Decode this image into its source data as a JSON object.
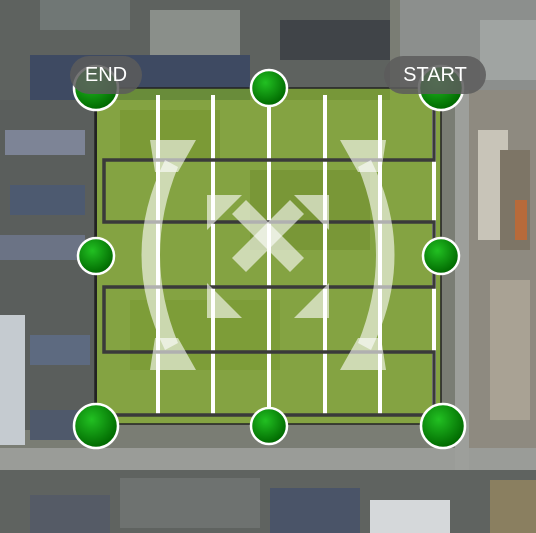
{
  "labels": {
    "start": "START",
    "end": "END"
  },
  "colors": {
    "area_fill": "#8dc21a",
    "grid_line": "#ffffff",
    "boundary": "#222222",
    "flight_path": "#3a3a3a",
    "handle": "#0a8a0a",
    "label_bg": "#5c5c5c"
  },
  "icons": [
    "corner-handle",
    "edge-handle",
    "move-arrows-icon",
    "rotate-arrows-icon"
  ]
}
